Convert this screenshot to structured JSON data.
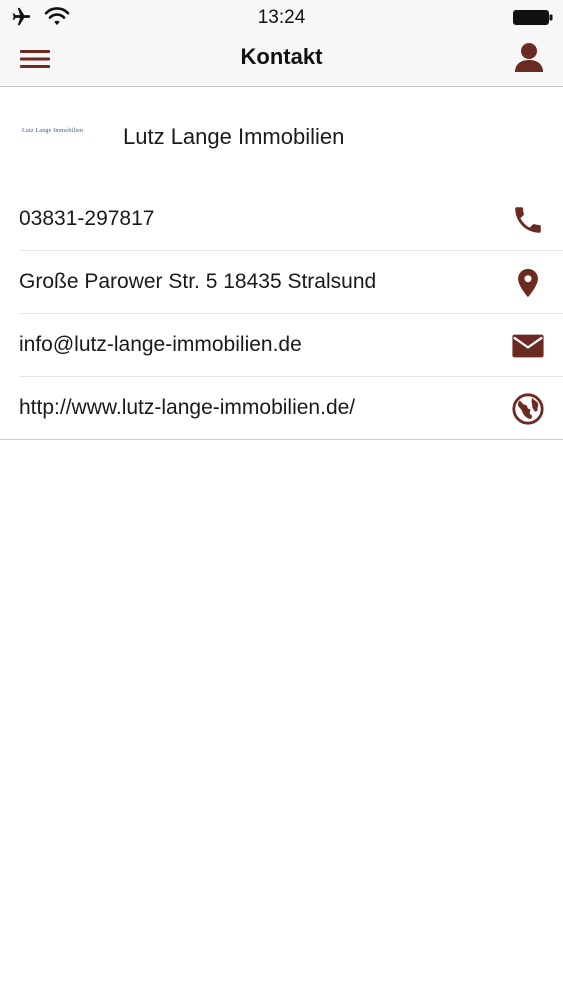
{
  "status_bar": {
    "time": "13:24",
    "icons": [
      "airplane-icon",
      "wifi-icon",
      "battery-icon"
    ]
  },
  "nav": {
    "title": "Kontakt",
    "left_icon": "menu-icon",
    "right_icon": "profile-icon"
  },
  "company": {
    "logo_text": "Lutz Lange Immobilien",
    "name": "Lutz Lange Immobilien"
  },
  "contacts": [
    {
      "text": "03831-297817",
      "icon": "phone-icon"
    },
    {
      "text": "Große Parower Str. 5 18435 Stralsund",
      "icon": "location-icon"
    },
    {
      "text": "info@lutz-lange-immobilien.de",
      "icon": "mail-icon"
    },
    {
      "text": "http://www.lutz-lange-immobilien.de/",
      "icon": "globe-icon"
    }
  ],
  "colors": {
    "accent": "#6b2a22",
    "bar_background": "#f7f7f7"
  }
}
